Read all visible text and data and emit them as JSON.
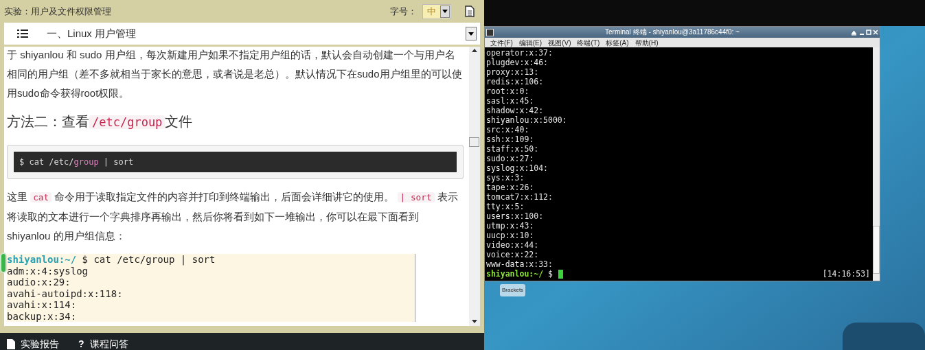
{
  "lesson_panel": {
    "title": "实验：用户及文件权限管理",
    "font_size_label": "字号：",
    "font_size_value": "中",
    "section_title": "一、Linux 用户管理",
    "content": [
      {
        "kind": "paragraph",
        "segments": [
          {
            "code": false,
            "text": "于 shiyanlou 和 sudo 用户组，每次新建用户如果不指定用户组的话，默认会自动创建一个与用户名相同的用户组（差不多就相当于家长的意思，或者说是老总）。默认情况下在sudo用户组里的可以使用sudo命令获得root权限。"
          }
        ]
      },
      {
        "kind": "heading",
        "segments": [
          {
            "code": false,
            "text": "方法二：查看"
          },
          {
            "code": true,
            "text": "/etc/group"
          },
          {
            "code": false,
            "text": "文件"
          }
        ]
      },
      {
        "kind": "codeblock",
        "tokens": [
          {
            "highlight": false,
            "text": "$ cat /etc/"
          },
          {
            "highlight": true,
            "text": "group"
          },
          {
            "highlight": false,
            "text": " | sort"
          }
        ]
      },
      {
        "kind": "paragraph",
        "segments": [
          {
            "code": false,
            "text": "这里 "
          },
          {
            "code": true,
            "text": "cat"
          },
          {
            "code": false,
            "text": " 命令用于读取指定文件的内容并打印到终端输出，后面会详细讲它的使用。 "
          },
          {
            "code": true,
            "text": "| sort"
          },
          {
            "code": false,
            "text": " 表示将读取的文本进行一个字典排序再输出，然后你将看到如下一堆输出，你可以在最下面看到 shiyanlou 的用户组信息："
          }
        ]
      },
      {
        "kind": "terminal_image",
        "prompt": "shiyanlou:~/",
        "command": "$ cat /etc/group | sort",
        "lines": [
          "adm:x:4:syslog",
          "audio:x:29:",
          "avahi-autoipd:x:118:",
          "avahi:x:114:",
          "backup:x:34:"
        ]
      }
    ]
  },
  "bottom_tabs": [
    {
      "kind": "report",
      "label": "实验报告"
    },
    {
      "kind": "questions",
      "icon_char": "?",
      "label": "课程问答"
    }
  ],
  "terminal": {
    "title": "Terminal 终端 - shiyanlou@3a11786c44f0: ~",
    "menus": [
      "文件(F)",
      "编辑(E)",
      "视图(V)",
      "终端(T)",
      "标签(A)",
      "帮助(H)"
    ],
    "lines": [
      "operator:x:37:",
      "plugdev:x:46:",
      "proxy:x:13:",
      "redis:x:106:",
      "root:x:0:",
      "sasl:x:45:",
      "shadow:x:42:",
      "shiyanlou:x:5000:",
      "src:x:40:",
      "ssh:x:109:",
      "staff:x:50:",
      "sudo:x:27:",
      "syslog:x:104:",
      "sys:x:3:",
      "tape:x:26:",
      "tomcat7:x:112:",
      "tty:x:5:",
      "users:x:100:",
      "utmp:x:43:",
      "uucp:x:10:",
      "video:x:44:",
      "voice:x:22:",
      "www-data:x:33:"
    ],
    "prompt": "shiyanlou:~/",
    "prompt_symbol": "$",
    "time": "[14:16:53]"
  },
  "desktop": {
    "icons": [
      "Brackets"
    ]
  }
}
